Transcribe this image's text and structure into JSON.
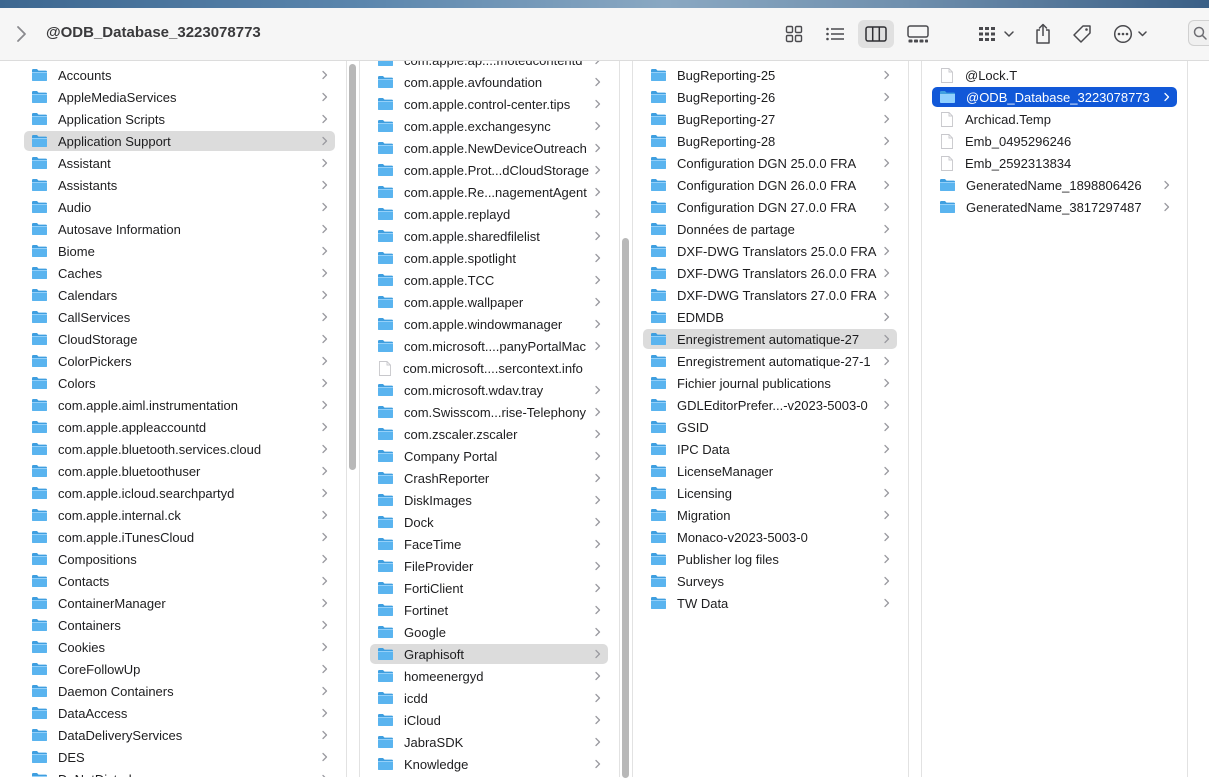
{
  "window": {
    "title": "@ODB_Database_3223078773"
  },
  "toolbar": {
    "view_icons": [
      "icon-view-icon",
      "list-view-icon",
      "column-view-icon",
      "gallery-view-icon"
    ],
    "actions": [
      "group-icon",
      "share-icon",
      "tag-icon",
      "more-icon"
    ]
  },
  "colors": {
    "selection_active": "#1158d8",
    "selection_inactive": "#dcdcdc",
    "folder": "#5ab4ef"
  },
  "columns": [
    {
      "items": [
        {
          "label": "Accounts",
          "kind": "folder"
        },
        {
          "label": "AppleMediaServices",
          "kind": "folder"
        },
        {
          "label": "Application Scripts",
          "kind": "folder"
        },
        {
          "label": "Application Support",
          "kind": "folder",
          "selected": "inactive"
        },
        {
          "label": "Assistant",
          "kind": "folder"
        },
        {
          "label": "Assistants",
          "kind": "folder"
        },
        {
          "label": "Audio",
          "kind": "folder"
        },
        {
          "label": "Autosave Information",
          "kind": "folder"
        },
        {
          "label": "Biome",
          "kind": "folder"
        },
        {
          "label": "Caches",
          "kind": "folder"
        },
        {
          "label": "Calendars",
          "kind": "folder"
        },
        {
          "label": "CallServices",
          "kind": "folder"
        },
        {
          "label": "CloudStorage",
          "kind": "folder"
        },
        {
          "label": "ColorPickers",
          "kind": "folder"
        },
        {
          "label": "Colors",
          "kind": "folder"
        },
        {
          "label": "com.apple.aiml.instrumentation",
          "kind": "folder"
        },
        {
          "label": "com.apple.appleaccountd",
          "kind": "folder"
        },
        {
          "label": "com.apple.bluetooth.services.cloud",
          "kind": "folder"
        },
        {
          "label": "com.apple.bluetoothuser",
          "kind": "folder"
        },
        {
          "label": "com.apple.icloud.searchpartyd",
          "kind": "folder"
        },
        {
          "label": "com.apple.internal.ck",
          "kind": "folder"
        },
        {
          "label": "com.apple.iTunesCloud",
          "kind": "folder"
        },
        {
          "label": "Compositions",
          "kind": "folder"
        },
        {
          "label": "Contacts",
          "kind": "folder"
        },
        {
          "label": "ContainerManager",
          "kind": "folder"
        },
        {
          "label": "Containers",
          "kind": "folder"
        },
        {
          "label": "Cookies",
          "kind": "folder"
        },
        {
          "label": "CoreFollowUp",
          "kind": "folder"
        },
        {
          "label": "Daemon Containers",
          "kind": "folder"
        },
        {
          "label": "DataAccess",
          "kind": "folder"
        },
        {
          "label": "DataDeliveryServices",
          "kind": "folder"
        },
        {
          "label": "DES",
          "kind": "folder"
        },
        {
          "label": "DoNotDisturb",
          "kind": "folder"
        }
      ]
    },
    {
      "items": [
        {
          "label": "com.apple.ap....motedcontentd",
          "kind": "folder"
        },
        {
          "label": "com.apple.avfoundation",
          "kind": "folder"
        },
        {
          "label": "com.apple.control-center.tips",
          "kind": "folder"
        },
        {
          "label": "com.apple.exchangesync",
          "kind": "folder"
        },
        {
          "label": "com.apple.NewDeviceOutreach",
          "kind": "folder"
        },
        {
          "label": "com.apple.Prot...dCloudStorage",
          "kind": "folder"
        },
        {
          "label": "com.apple.Re...nagementAgent",
          "kind": "folder"
        },
        {
          "label": "com.apple.replayd",
          "kind": "folder"
        },
        {
          "label": "com.apple.sharedfilelist",
          "kind": "folder"
        },
        {
          "label": "com.apple.spotlight",
          "kind": "folder"
        },
        {
          "label": "com.apple.TCC",
          "kind": "folder"
        },
        {
          "label": "com.apple.wallpaper",
          "kind": "folder"
        },
        {
          "label": "com.apple.windowmanager",
          "kind": "folder"
        },
        {
          "label": "com.microsoft....panyPortalMac",
          "kind": "folder"
        },
        {
          "label": "com.microsoft....sercontext.info",
          "kind": "file"
        },
        {
          "label": "com.microsoft.wdav.tray",
          "kind": "folder"
        },
        {
          "label": "com.Swisscom...rise-Telephony",
          "kind": "folder"
        },
        {
          "label": "com.zscaler.zscaler",
          "kind": "folder"
        },
        {
          "label": "Company Portal",
          "kind": "folder"
        },
        {
          "label": "CrashReporter",
          "kind": "folder"
        },
        {
          "label": "DiskImages",
          "kind": "folder"
        },
        {
          "label": "Dock",
          "kind": "folder"
        },
        {
          "label": "FaceTime",
          "kind": "folder"
        },
        {
          "label": "FileProvider",
          "kind": "folder"
        },
        {
          "label": "FortiClient",
          "kind": "folder"
        },
        {
          "label": "Fortinet",
          "kind": "folder"
        },
        {
          "label": "Google",
          "kind": "folder"
        },
        {
          "label": "Graphisoft",
          "kind": "folder",
          "selected": "inactive"
        },
        {
          "label": "homeenergyd",
          "kind": "folder"
        },
        {
          "label": "icdd",
          "kind": "folder"
        },
        {
          "label": "iCloud",
          "kind": "folder"
        },
        {
          "label": "JabraSDK",
          "kind": "folder"
        },
        {
          "label": "Knowledge",
          "kind": "folder"
        }
      ]
    },
    {
      "items": [
        {
          "label": "BugReporting-25",
          "kind": "folder"
        },
        {
          "label": "BugReporting-26",
          "kind": "folder"
        },
        {
          "label": "BugReporting-27",
          "kind": "folder"
        },
        {
          "label": "BugReporting-28",
          "kind": "folder"
        },
        {
          "label": "Configuration DGN 25.0.0 FRA",
          "kind": "folder"
        },
        {
          "label": "Configuration DGN 26.0.0 FRA",
          "kind": "folder"
        },
        {
          "label": "Configuration DGN 27.0.0 FRA",
          "kind": "folder"
        },
        {
          "label": "Données de partage",
          "kind": "folder"
        },
        {
          "label": "DXF-DWG Translators 25.0.0 FRA",
          "kind": "folder"
        },
        {
          "label": "DXF-DWG Translators 26.0.0 FRA",
          "kind": "folder"
        },
        {
          "label": "DXF-DWG Translators 27.0.0 FRA",
          "kind": "folder"
        },
        {
          "label": "EDMDB",
          "kind": "folder"
        },
        {
          "label": "Enregistrement automatique-27",
          "kind": "folder",
          "selected": "inactive"
        },
        {
          "label": "Enregistrement automatique-27-1",
          "kind": "folder"
        },
        {
          "label": "Fichier journal publications",
          "kind": "folder"
        },
        {
          "label": "GDLEditorPrefer...-v2023-5003-0",
          "kind": "folder"
        },
        {
          "label": "GSID",
          "kind": "folder"
        },
        {
          "label": "IPC Data",
          "kind": "folder"
        },
        {
          "label": "LicenseManager",
          "kind": "folder"
        },
        {
          "label": "Licensing",
          "kind": "folder"
        },
        {
          "label": "Migration",
          "kind": "folder"
        },
        {
          "label": "Monaco-v2023-5003-0",
          "kind": "folder"
        },
        {
          "label": "Publisher log files",
          "kind": "folder"
        },
        {
          "label": "Surveys",
          "kind": "folder"
        },
        {
          "label": "TW Data",
          "kind": "folder"
        }
      ]
    },
    {
      "items": [
        {
          "label": "@Lock.T",
          "kind": "file"
        },
        {
          "label": "@ODB_Database_3223078773",
          "kind": "folder",
          "selected": "active"
        },
        {
          "label": "Archicad.Temp",
          "kind": "file"
        },
        {
          "label": "Emb_0495296246",
          "kind": "file"
        },
        {
          "label": "Emb_2592313834",
          "kind": "file"
        },
        {
          "label": "GeneratedName_1898806426",
          "kind": "folder"
        },
        {
          "label": "GeneratedName_3817297487",
          "kind": "folder"
        }
      ]
    }
  ]
}
